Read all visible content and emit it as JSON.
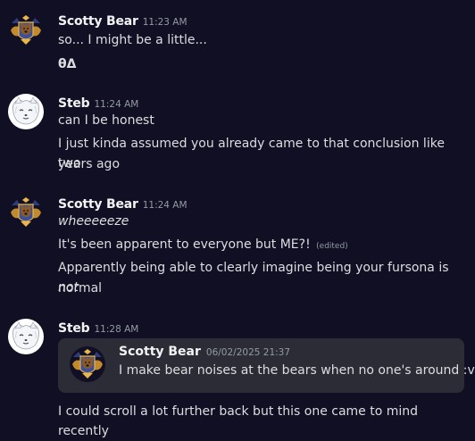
{
  "messages": [
    {
      "author": "Scotty Bear",
      "timestamp": "11:23 AM",
      "avatar": "bear-crest-avatar",
      "lines": [
        "so... I might be a little...",
        "θΔ"
      ]
    },
    {
      "author": "Steb",
      "timestamp": "11:24 AM",
      "avatar": "white-fox-avatar",
      "lines": [
        "can I be honest",
        "I just kinda assumed you already came to that conclusion like two",
        "years ago"
      ]
    },
    {
      "author": "Scotty Bear",
      "timestamp": "11:24 AM",
      "avatar": "bear-crest-avatar",
      "lines": [
        "wheeeeeze",
        "It's been apparent to everyone but ME?!",
        "Apparently being able to clearly imagine being your fursona is ",
        "not",
        "normal"
      ],
      "edited_label": "(edited)"
    },
    {
      "author": "Steb",
      "timestamp": "11:28 AM",
      "avatar": "white-fox-avatar",
      "embed": {
        "author": "Scotty Bear",
        "date": "06/02/2025 21:37",
        "text": "I make bear noises at the bears when no one's around :v"
      },
      "lines": [
        "I could scroll a lot further back but this one came to mind recently"
      ]
    }
  ],
  "colors": {
    "background": "#100f23",
    "username": "#f2f3f5",
    "timestamp": "#949ba4",
    "text": "#dbdee1",
    "embed_background": "#2b2c35"
  }
}
